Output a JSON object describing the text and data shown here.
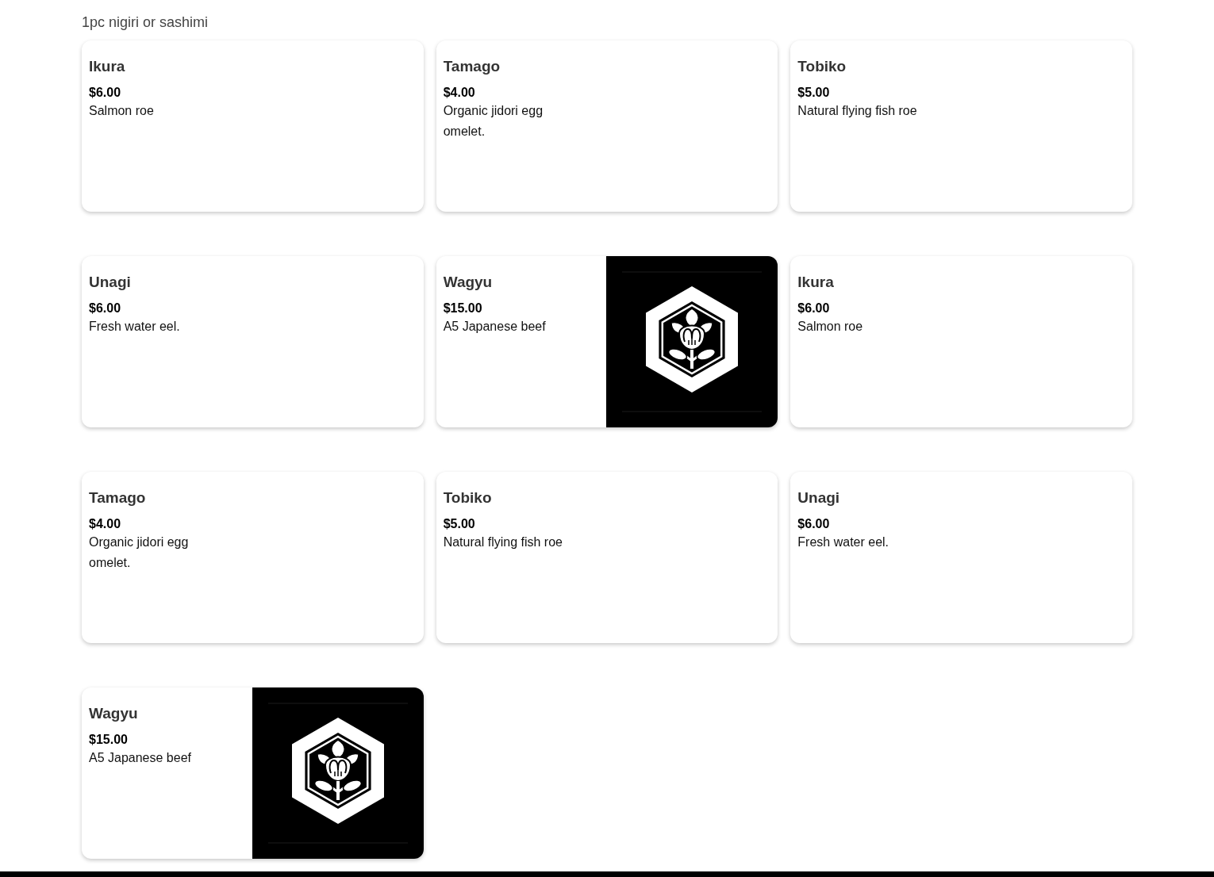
{
  "section": {
    "subtitle": "1pc nigiri or sashimi"
  },
  "items": [
    {
      "kind": "plain",
      "name": "Ikura",
      "price": "$6.00",
      "description": "Salmon roe"
    },
    {
      "kind": "plain",
      "name": "Tamago",
      "price": "$4.00",
      "description": "Organic jidori egg omelet."
    },
    {
      "kind": "plain",
      "name": "Tobiko",
      "price": "$5.00",
      "description": "Natural flying fish roe"
    },
    {
      "kind": "plain",
      "name": "Unagi",
      "price": "$6.00",
      "description": "Fresh water eel."
    },
    {
      "kind": "image",
      "name": "Wagyu",
      "price": "$15.00",
      "description": "A5 Japanese beef"
    },
    {
      "kind": "plain",
      "name": "Ikura",
      "price": "$6.00",
      "description": "Salmon roe"
    },
    {
      "kind": "plain",
      "name": "Tamago",
      "price": "$4.00",
      "description": "Organic jidori egg omelet."
    },
    {
      "kind": "plain",
      "name": "Tobiko",
      "price": "$5.00",
      "description": "Natural flying fish roe"
    },
    {
      "kind": "plain",
      "name": "Unagi",
      "price": "$6.00",
      "description": "Fresh water eel."
    },
    {
      "kind": "image",
      "name": "Wagyu",
      "price": "$15.00",
      "description": "A5 Japanese beef"
    }
  ]
}
